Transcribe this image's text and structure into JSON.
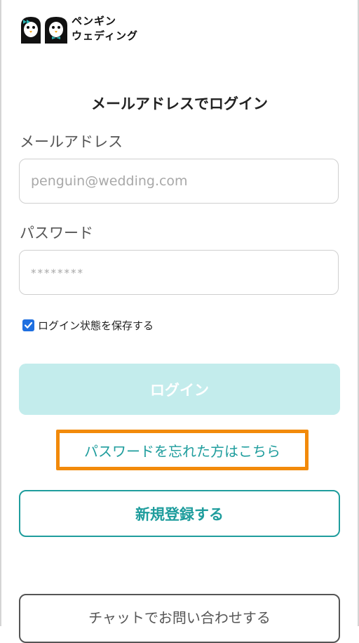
{
  "brand": {
    "line1": "ペンギン",
    "line2": "ウェディング"
  },
  "form": {
    "title": "メールアドレスでログイン",
    "email_label": "メールアドレス",
    "email_placeholder": "penguin@wedding.com",
    "email_value": "",
    "password_label": "パスワード",
    "password_placeholder": "********",
    "password_value": "",
    "remember_label": "ログイン状態を保存する",
    "remember_checked": true
  },
  "buttons": {
    "login": "ログイン",
    "forgot_password": "パスワードを忘れた方はこちら",
    "signup": "新規登録する",
    "chat": "チャットでお問い合わせする"
  },
  "colors": {
    "accent": "#1f9d9d",
    "login_disabled_bg": "#c3ecec",
    "highlight_border": "#f28a0a",
    "checkbox": "#1e6fe0"
  },
  "icons": {
    "logo": "penguin-couple-logo",
    "check": "check-icon"
  }
}
